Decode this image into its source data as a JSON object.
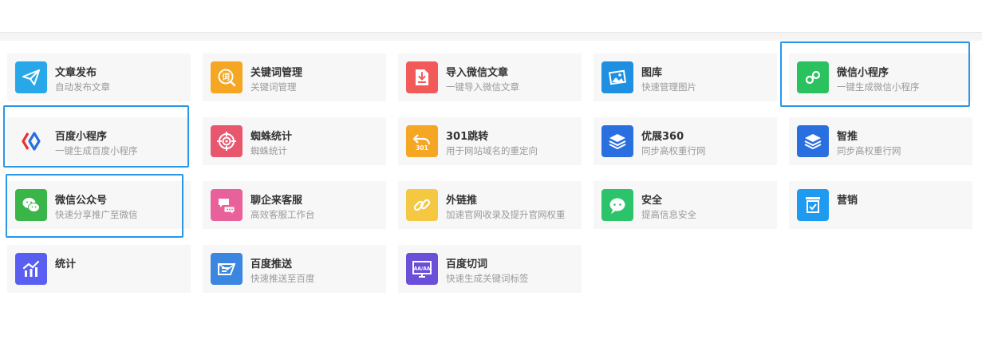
{
  "highlight_color": "#2a96e8",
  "cards": [
    {
      "title": "文章发布",
      "desc": "自动发布文章",
      "icon": "paper-plane-icon",
      "color": "#28a8e8"
    },
    {
      "title": "关键词管理",
      "desc": "关键词管理",
      "icon": "keyword-search-icon",
      "color": "#f5a623"
    },
    {
      "title": "导入微信文章",
      "desc": "一键导入微信文章",
      "icon": "import-document-icon",
      "color": "#f25a5a"
    },
    {
      "title": "图库",
      "desc": "快速管理图片",
      "icon": "gallery-icon",
      "color": "#1e8fe1"
    },
    {
      "title": "微信小程序",
      "desc": "一键生成微信小程序",
      "icon": "mini-program-icon",
      "color": "#2ac15f"
    },
    {
      "title": "百度小程序",
      "desc": "一键生成百度小程序",
      "icon": "baidu-mini-program-icon",
      "color": "#f7f7f7"
    },
    {
      "title": "蜘蛛统计",
      "desc": "蜘蛛统计",
      "icon": "target-icon",
      "color": "#e9576f"
    },
    {
      "title": "301跳转",
      "desc": "用于网站域名的重定向",
      "icon": "redirect-301-icon",
      "color": "#f5a623",
      "badge": "301"
    },
    {
      "title": "优展360",
      "desc": "同步高权重行网",
      "icon": "layers-icon",
      "color": "#2a6fe0"
    },
    {
      "title": "智推",
      "desc": "同步高权重行网",
      "icon": "layers-icon",
      "color": "#2a6fe0"
    },
    {
      "title": "微信公众号",
      "desc": "快速分享推广至微信",
      "icon": "wechat-icon",
      "color": "#3ab54a"
    },
    {
      "title": "聊企来客服",
      "desc": "高效客服工作台",
      "icon": "chat-bubbles-icon",
      "color": "#e8619a"
    },
    {
      "title": "外链推",
      "desc": "加速官网收录及提升官网权重",
      "icon": "link-icon",
      "color": "#f5c842"
    },
    {
      "title": "安全",
      "desc": "提高信息安全",
      "icon": "shield-chat-icon",
      "color": "#2cc46a"
    },
    {
      "title": "营销",
      "desc": "",
      "icon": "marketing-icon",
      "color": "#1e9bf0"
    },
    {
      "title": "统计",
      "desc": "",
      "icon": "bar-chart-icon",
      "color": "#5a5ff2"
    },
    {
      "title": "百度推送",
      "desc": "快速推送至百度",
      "icon": "push-icon",
      "color": "#3a86e0"
    },
    {
      "title": "百度切词",
      "desc": "快速生成关键词标签",
      "icon": "word-split-icon",
      "color": "#6b4fd8",
      "badge": "AA/AA"
    }
  ]
}
